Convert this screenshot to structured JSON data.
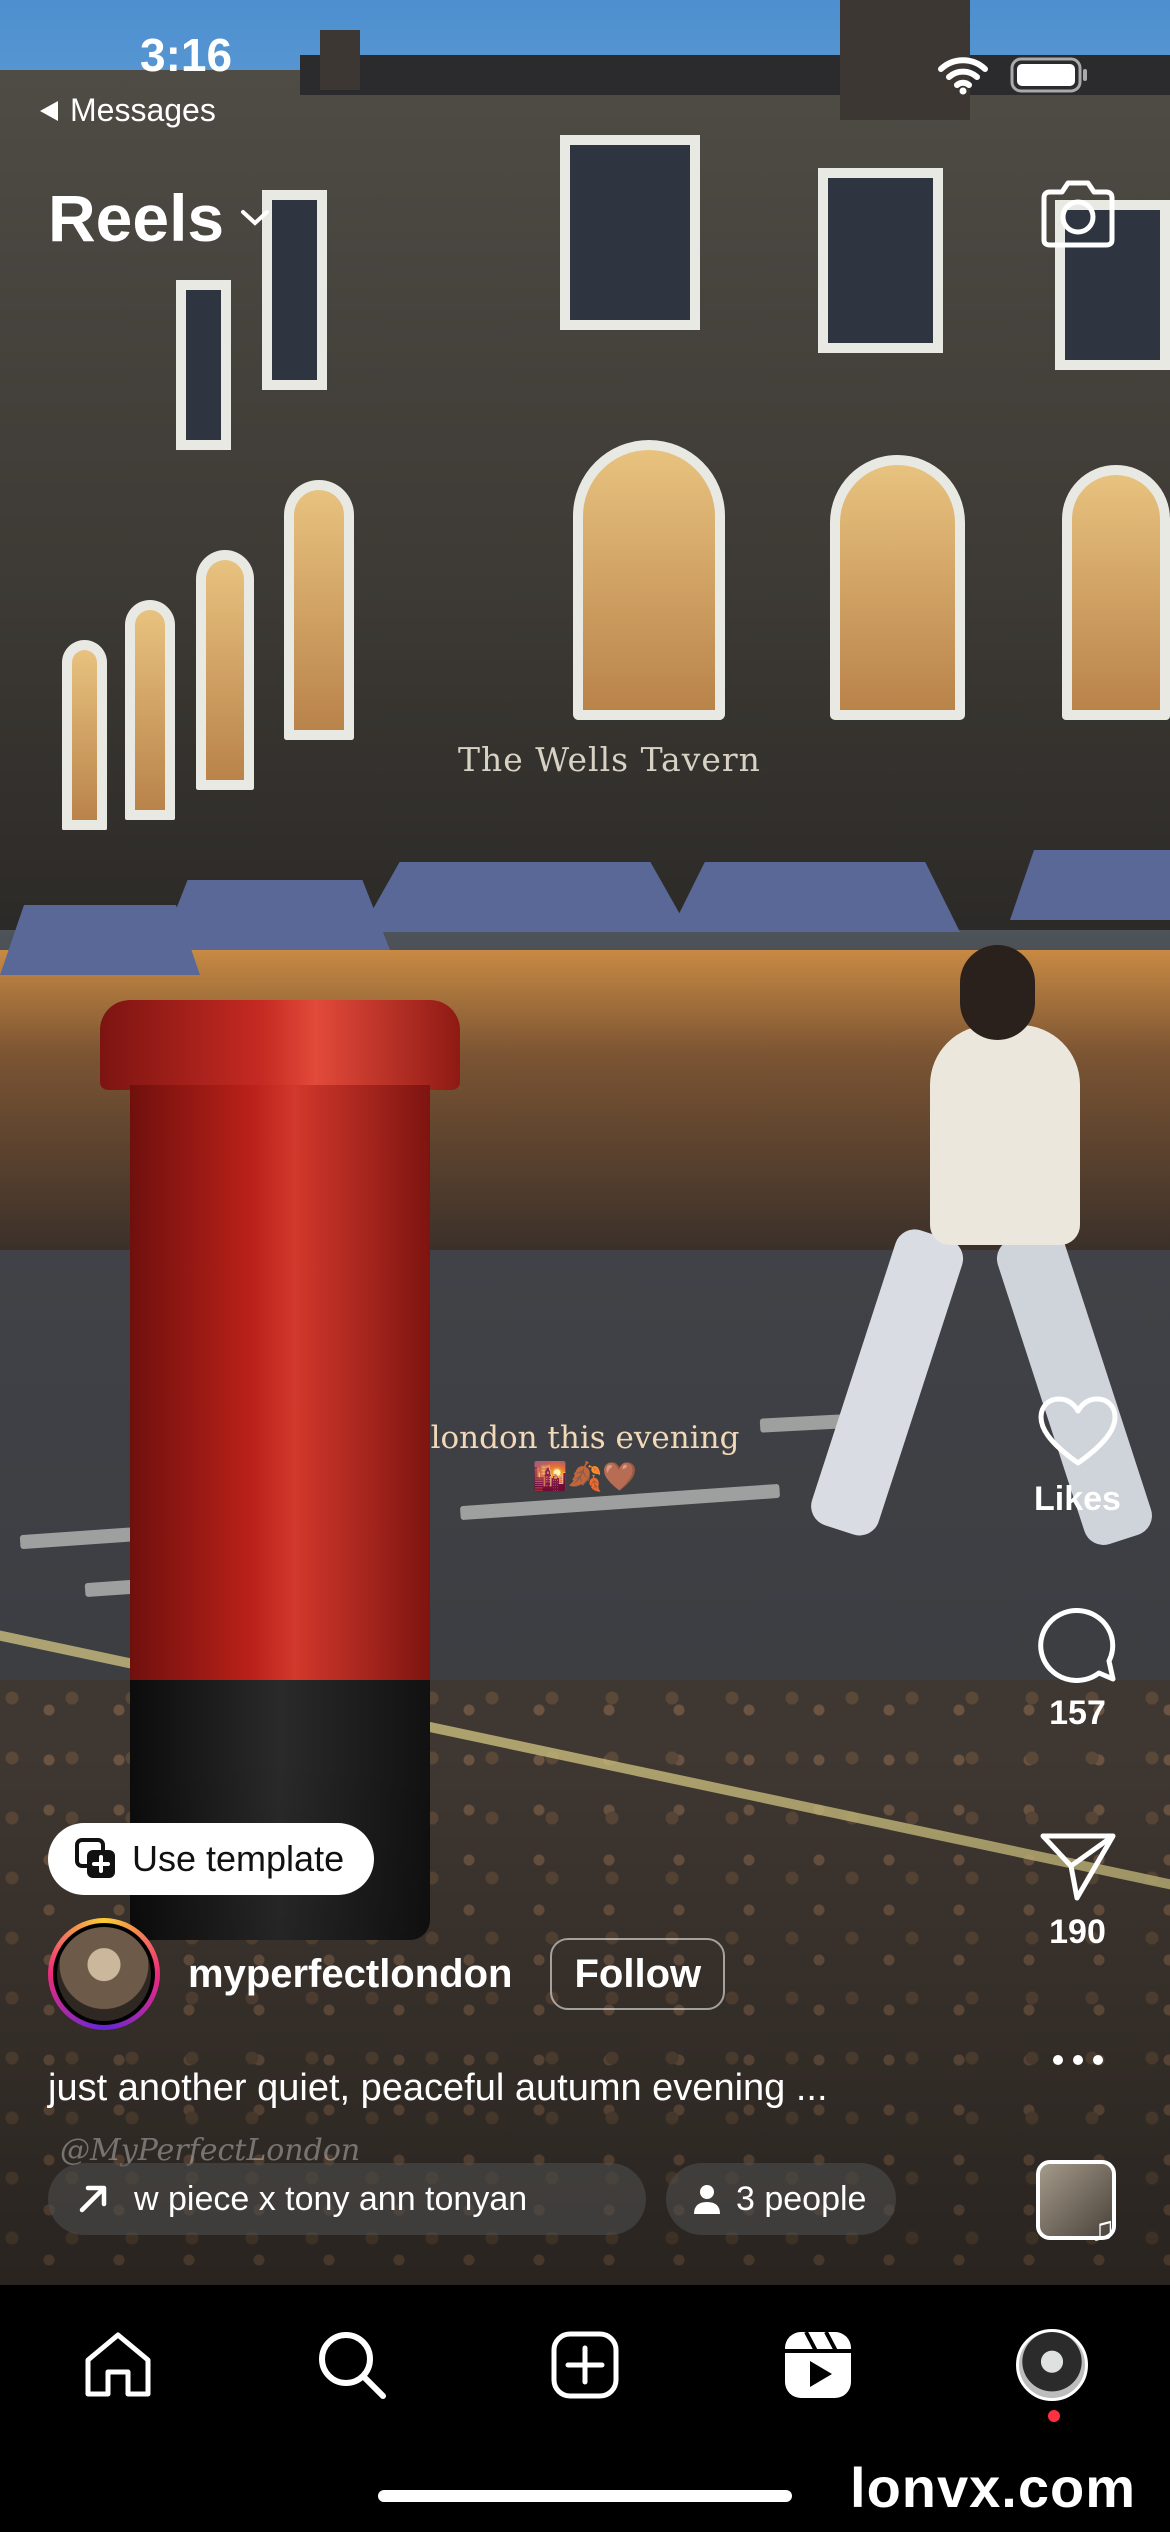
{
  "status_bar": {
    "time": "3:16",
    "back_label": "Messages"
  },
  "header": {
    "title": "Reels"
  },
  "video_overlay": {
    "caption_line": "london this evening",
    "caption_emojis": "🌇🍂🤎",
    "watermark": "@MyPerfectLondon"
  },
  "actions": {
    "likes_label": "Likes",
    "comments_count": "157",
    "shares_count": "190"
  },
  "reel": {
    "use_template_label": "Use template",
    "username": "myperfectlondon",
    "follow_label": "Follow",
    "caption": "just another quiet, peaceful autumn evening ...",
    "audio_text": "w piece x tony ann    tonyan",
    "people_label": "3 people"
  },
  "footer": {
    "site_mark": "lonvx.com"
  },
  "colors": {
    "postbox_red": "#c62a22",
    "notification_red": "#ff3040",
    "tabbar_bg": "#000000"
  }
}
